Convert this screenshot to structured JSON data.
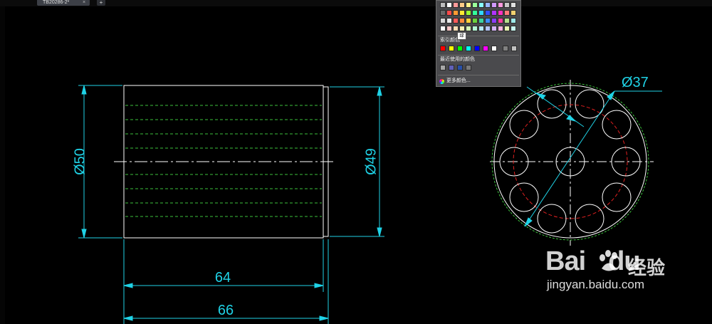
{
  "tabs": {
    "active_label": "TB20286-2*",
    "close_glyph": "×",
    "add_glyph": "+"
  },
  "drawing": {
    "dim_diameter_50": "Ø50",
    "dim_diameter_49": "Ø49",
    "dim_length_64": "64",
    "dim_length_66": "66",
    "dim_diameter_37": "Ø37",
    "colors": {
      "outline": "#ffffff",
      "dimension": "#1fd2e6",
      "hidden_line": "#3cc03c",
      "bolt_circle": "#e02020"
    }
  },
  "palette": {
    "tooltip": "绿",
    "index_colors_label": "索引颜色",
    "recent_colors_label": "最近使用的颜色",
    "more_colors_label": "更多颜色...",
    "index_grid_rows": [
      [
        "#bdbdbd",
        "#ffffff",
        "#ff9a9a",
        "#ffcc88",
        "#fff08a",
        "#9aff9a",
        "#88ffff",
        "#9ab8ff",
        "#d29aff",
        "#ff9ae0",
        "#c8c8c8",
        "#e0e0e0"
      ],
      [
        "#6a6a6a",
        "#ff4a4a",
        "#ff9a33",
        "#ffea33",
        "#9bff33",
        "#33ff9b",
        "#33d7ff",
        "#334dff",
        "#b233ff",
        "#ff33c1",
        "#ff7a7a",
        "#f0d070"
      ],
      [
        "#d8d8d8",
        "#eaeaea",
        "#ff5a5a",
        "#ff8c3c",
        "#ffd23c",
        "#6bd23c",
        "#3cd2a0",
        "#3c8cff",
        "#8c3cff",
        "#ff3ca0",
        "#b4e08c",
        "#9ee8e8"
      ],
      [
        "#ffffff",
        "#f6c6c6",
        "#f6dcb4",
        "#f6f0b4",
        "#d4f6b4",
        "#b4f6d4",
        "#b4e6f6",
        "#b4c4f6",
        "#d4b4f6",
        "#f6b4e0",
        "#e8f6b4",
        "#c8f6f0"
      ]
    ],
    "index_colors": [
      "#ff0000",
      "#ffff00",
      "#00ff00",
      "#00ffff",
      "#0000ff",
      "#ff00ff",
      "#ffffff",
      "#808080",
      "#c0c0c0"
    ],
    "recent_colors": [
      "#a8a8a8",
      "#6060b8",
      "#2850a8",
      "#7a7a7a"
    ]
  },
  "watermark": {
    "logo": "Bai",
    "logo_tail": "du",
    "chinese": "经验",
    "url": "jingyan.baidu.com"
  }
}
